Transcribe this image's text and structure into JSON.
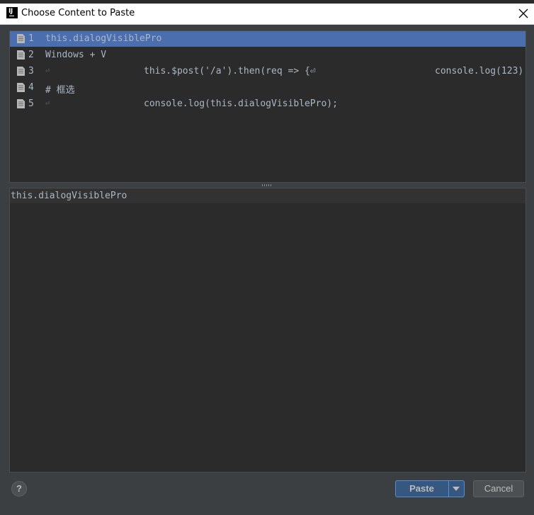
{
  "window": {
    "title": "Choose Content to Paste",
    "app_icon_text": "IJ",
    "close_glyph": "✕"
  },
  "clipboard_items": [
    {
      "num": "1",
      "segments": [
        "this.dialogVisiblePro"
      ],
      "selected": true
    },
    {
      "num": "2",
      "segments": [
        "Windows + V"
      ],
      "selected": false
    },
    {
      "num": "3",
      "segments": [
        "⏎",
        "this.$post('/a').then(req => {⏎",
        "console.log(123)"
      ],
      "selected": false
    },
    {
      "num": "4",
      "segments": [
        "#  框选"
      ],
      "selected": false
    },
    {
      "num": "5",
      "segments": [
        "⏎",
        "console.log(this.dialogVisiblePro);"
      ],
      "selected": false
    }
  ],
  "preview": {
    "text": "this.dialogVisiblePro"
  },
  "footer": {
    "help_label": "?",
    "paste_label": "Paste",
    "cancel_label": "Cancel"
  },
  "colors": {
    "selection": "#4b6eaf",
    "editor_bg": "#2b2b2b",
    "dialog_bg": "#3c3f41",
    "text": "#a9b7c6",
    "default_button": "#365880"
  }
}
